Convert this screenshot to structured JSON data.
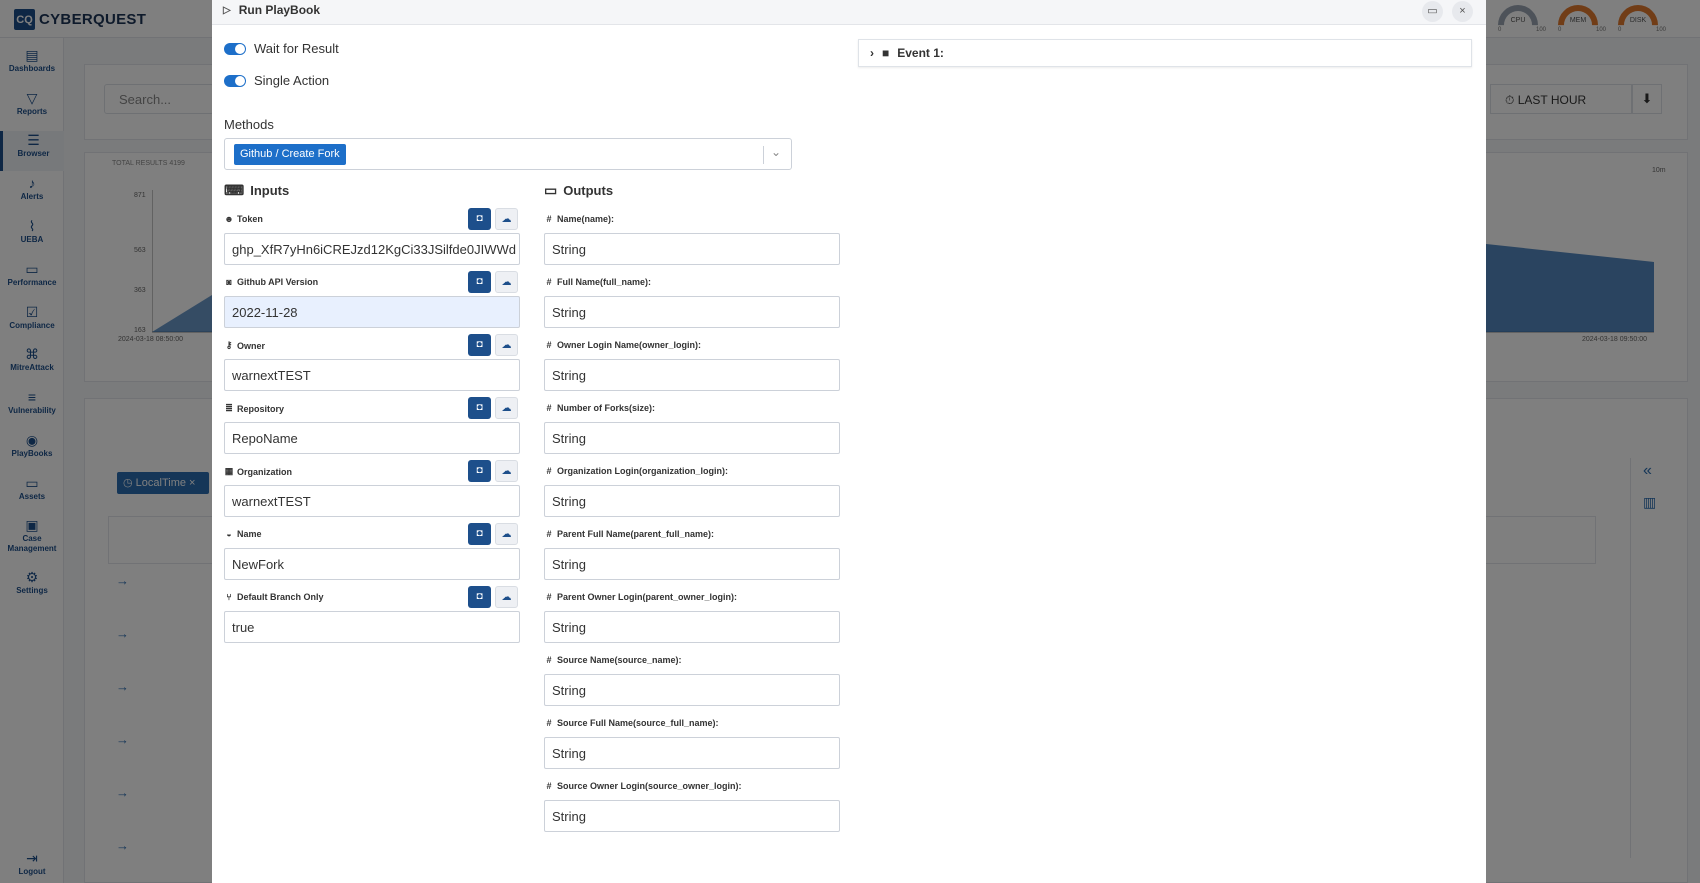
{
  "app": {
    "logo_mark": "CQ",
    "logo_text": "CYBERQUEST",
    "gauges": [
      {
        "label": "CPU",
        "min": "0",
        "max": "100"
      },
      {
        "label": "MEM",
        "min": "0",
        "max": "100"
      },
      {
        "label": "DISK",
        "min": "0",
        "max": "100"
      }
    ],
    "sidebar": [
      {
        "label": "Dashboards",
        "icon": "chart-icon"
      },
      {
        "label": "Reports",
        "icon": "filter-icon"
      },
      {
        "label": "Browser",
        "icon": "list-icon"
      },
      {
        "label": "Alerts",
        "icon": "bell-icon"
      },
      {
        "label": "UEBA",
        "icon": "line-chart-icon"
      },
      {
        "label": "Performance",
        "icon": "keyboard-icon"
      },
      {
        "label": "Compliance",
        "icon": "check-doc-icon"
      },
      {
        "label": "MitreAttack",
        "icon": "network-icon"
      },
      {
        "label": "Vulnerability",
        "icon": "server-icon"
      },
      {
        "label": "PlayBooks",
        "icon": "playbook-icon"
      },
      {
        "label": "Assets",
        "icon": "monitor-icon"
      },
      {
        "label": "Case Management",
        "icon": "briefcase-icon"
      },
      {
        "label": "Settings",
        "icon": "gear-icon"
      },
      {
        "label": "Logout",
        "icon": "logout-icon"
      }
    ],
    "search_placeholder": "Search...",
    "time_range": "LAST HOUR",
    "total_results_label": "TOTAL RESULTS",
    "total_results_value": "4199",
    "chart_y_ticks": [
      "871",
      "563",
      "363",
      "163"
    ],
    "chart_x_start": "2024-03-18 08:50:00",
    "chart_x_end": "2024-03-18 09:50:00",
    "chart_interval": "10m",
    "filter_chip": "LocalTime"
  },
  "modal": {
    "title": "Run PlayBook",
    "wait_for_result": "Wait for Result",
    "single_action": "Single Action",
    "methods_label": "Methods",
    "selected_method": "Github / Create Fork",
    "inputs_title": "Inputs",
    "outputs_title": "Outputs",
    "event_title": "Event 1:",
    "inputs": [
      {
        "label": "Token",
        "icon": "user-circle-icon",
        "value": "ghp_XfR7yHn6iCREJzd12KgCi33JSilfde0JIWWd"
      },
      {
        "label": "Github API Version",
        "icon": "github-icon",
        "value": "2022-11-28"
      },
      {
        "label": "Owner",
        "icon": "key-icon",
        "value": "warnextTEST"
      },
      {
        "label": "Repository",
        "icon": "database-icon",
        "value": "RepoName"
      },
      {
        "label": "Organization",
        "icon": "building-icon",
        "value": "warnextTEST"
      },
      {
        "label": "Name",
        "icon": "user-badge-icon",
        "value": "NewFork"
      },
      {
        "label": "Default Branch Only",
        "icon": "branch-icon",
        "value": "true"
      }
    ],
    "outputs": [
      {
        "label": "Name(name):",
        "value": "String"
      },
      {
        "label": "Full Name(full_name):",
        "value": "String"
      },
      {
        "label": "Owner Login Name(owner_login):",
        "value": "String"
      },
      {
        "label": "Number of Forks(size):",
        "value": "String"
      },
      {
        "label": "Organization Login(organization_login):",
        "value": "String"
      },
      {
        "label": "Parent Full Name(parent_full_name):",
        "value": "String"
      },
      {
        "label": "Parent Owner Login(parent_owner_login):",
        "value": "String"
      },
      {
        "label": "Source Name(source_name):",
        "value": "String"
      },
      {
        "label": "Source Full Name(source_full_name):",
        "value": "String"
      },
      {
        "label": "Source Owner Login(source_owner_login):",
        "value": "String"
      }
    ]
  },
  "colors": {
    "primary": "#1d6fc9",
    "dark_button": "#1d4f8b",
    "highlight_field": "#e8f0fe"
  }
}
